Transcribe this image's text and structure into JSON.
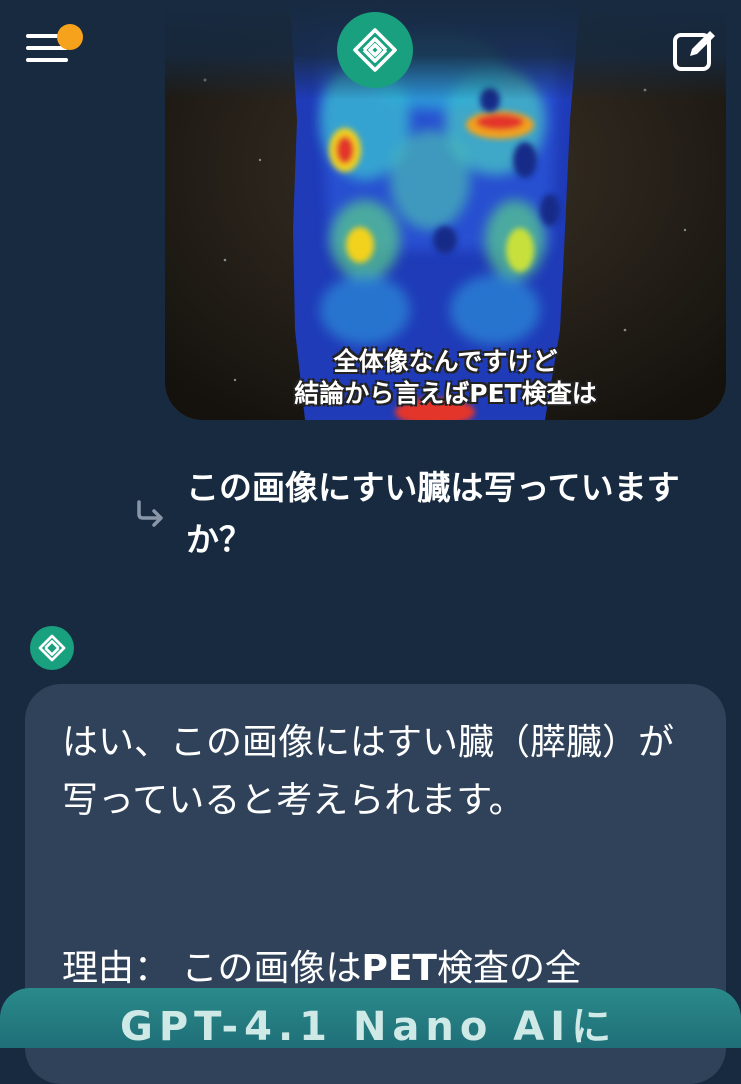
{
  "header": {
    "menu_icon": "hamburger-menu-icon",
    "logo_icon": "app-logo-icon",
    "compose_icon": "new-chat-icon",
    "notification_color": "#f7a21c"
  },
  "image": {
    "caption_line1": "全体像なんですけど",
    "caption_line2": "結論から言えばPET検査は"
  },
  "question": {
    "text": "この画像にすい臓は写っていますか？"
  },
  "answer": {
    "paragraph1": "はい、この画像にはすい臓（膵臓）が写っていると考えられます。",
    "paragraph2_prefix": "理由：  この画像は",
    "paragraph2_bold": "PET",
    "paragraph2_suffix": "検査の全"
  },
  "bottom_banner": {
    "text": "GPT-4.1 Nano AIに"
  },
  "colors": {
    "background": "#172a40",
    "accent": "#19a07e",
    "answer_bubble": "#2f425a"
  }
}
